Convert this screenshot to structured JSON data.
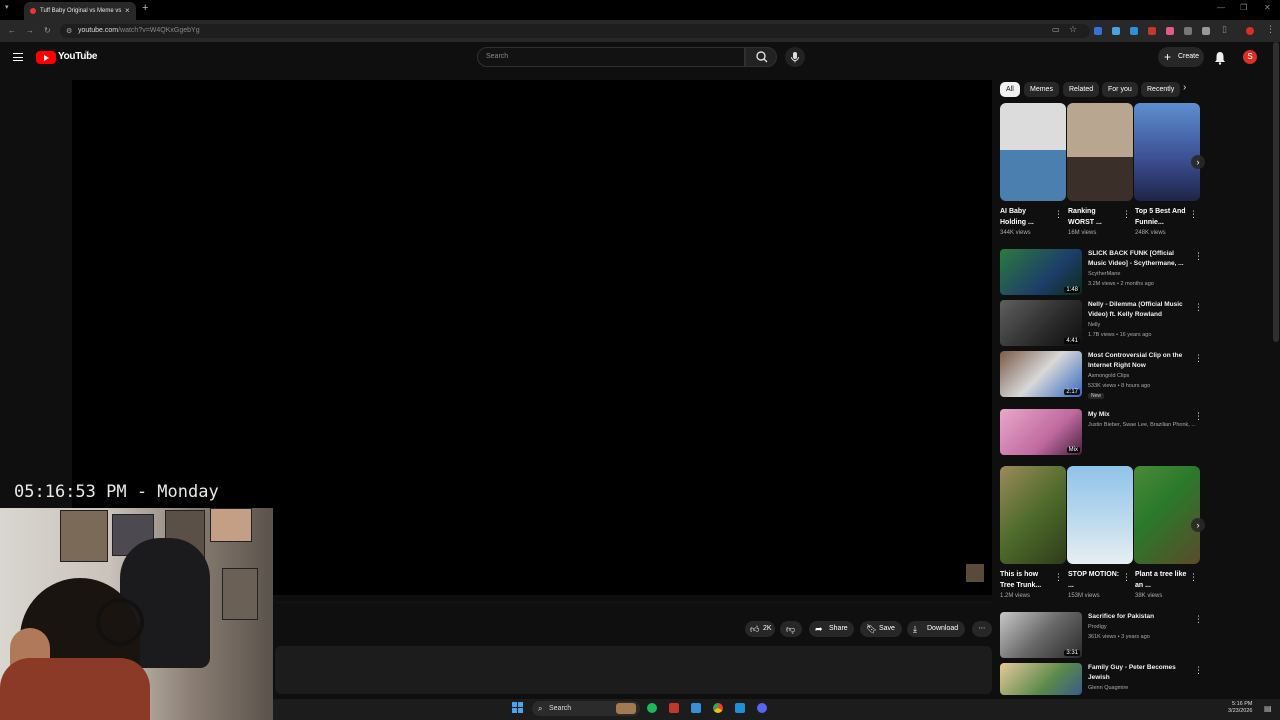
{
  "browser": {
    "tab_title": "Tuff Baby Original vs Meme vs",
    "url": "youtube.com",
    "url_path": "/watch?v=W4QKxGgebYg"
  },
  "header": {
    "logo_text": "YouTube",
    "logo_sup": "IN",
    "search_placeholder": "Search",
    "create_label": "Create",
    "avatar_letter": "S"
  },
  "overlay": {
    "clock": "05:16:53 PM - Monday"
  },
  "actions": {
    "like_count": "2K",
    "share_label": "Share",
    "save_label": "Save",
    "download_label": "Download"
  },
  "chips": [
    "All",
    "Memes",
    "Related",
    "For you",
    "Recently"
  ],
  "shorts_row_1": [
    {
      "title": "AI Baby Holding ...",
      "views": "344K views"
    },
    {
      "title": "Ranking WORST ...",
      "views": "16M views"
    },
    {
      "title": "Top 5 Best And Funnie...",
      "views": "248K views"
    }
  ],
  "videos_1": [
    {
      "title": "SLICK BACK FUNK [Official Music Video] - Scythermane, ...",
      "channel": "ScytherMane",
      "meta": "3.2M views • 2 months ago",
      "duration": "1:48"
    },
    {
      "title": "Nelly - Dilemma (Official Music Video) ft. Kelly Rowland",
      "channel": "Nelly",
      "meta": "1.7B views • 16 years ago",
      "duration": "4:41"
    },
    {
      "title": "Most Controversial Clip on the Internet Right Now",
      "channel": "Asmongold Clips",
      "meta": "533K views • 8 hours ago",
      "duration": "2:17",
      "badge": "New"
    },
    {
      "title": "My Mix",
      "channel": "Justin Bieber, Swae Lee, Brazilian Phonk, ...",
      "meta": "",
      "duration": "Mix"
    }
  ],
  "shorts_row_2": [
    {
      "title": "This is how Tree Trunk...",
      "views": "1.2M views"
    },
    {
      "title": "STOP MOTION: ...",
      "views": "153M views"
    },
    {
      "title": "Plant a tree like an ...",
      "views": "38K views"
    }
  ],
  "videos_2": [
    {
      "title": "Sacrifice for Pakistan",
      "channel": "Prodigy",
      "meta": "361K views • 3 years ago",
      "duration": "3:31"
    },
    {
      "title": "Family Guy - Peter Becomes Jewish",
      "channel": "Glenn Quagmire",
      "meta": "",
      "duration": ""
    }
  ],
  "taskbar": {
    "search_label": "Search",
    "time": "5:16 PM",
    "date": "3/23/2026"
  },
  "colors": {
    "brand_red": "#ff0000",
    "background": "#0f0f0f",
    "chip_bg": "#272727"
  }
}
